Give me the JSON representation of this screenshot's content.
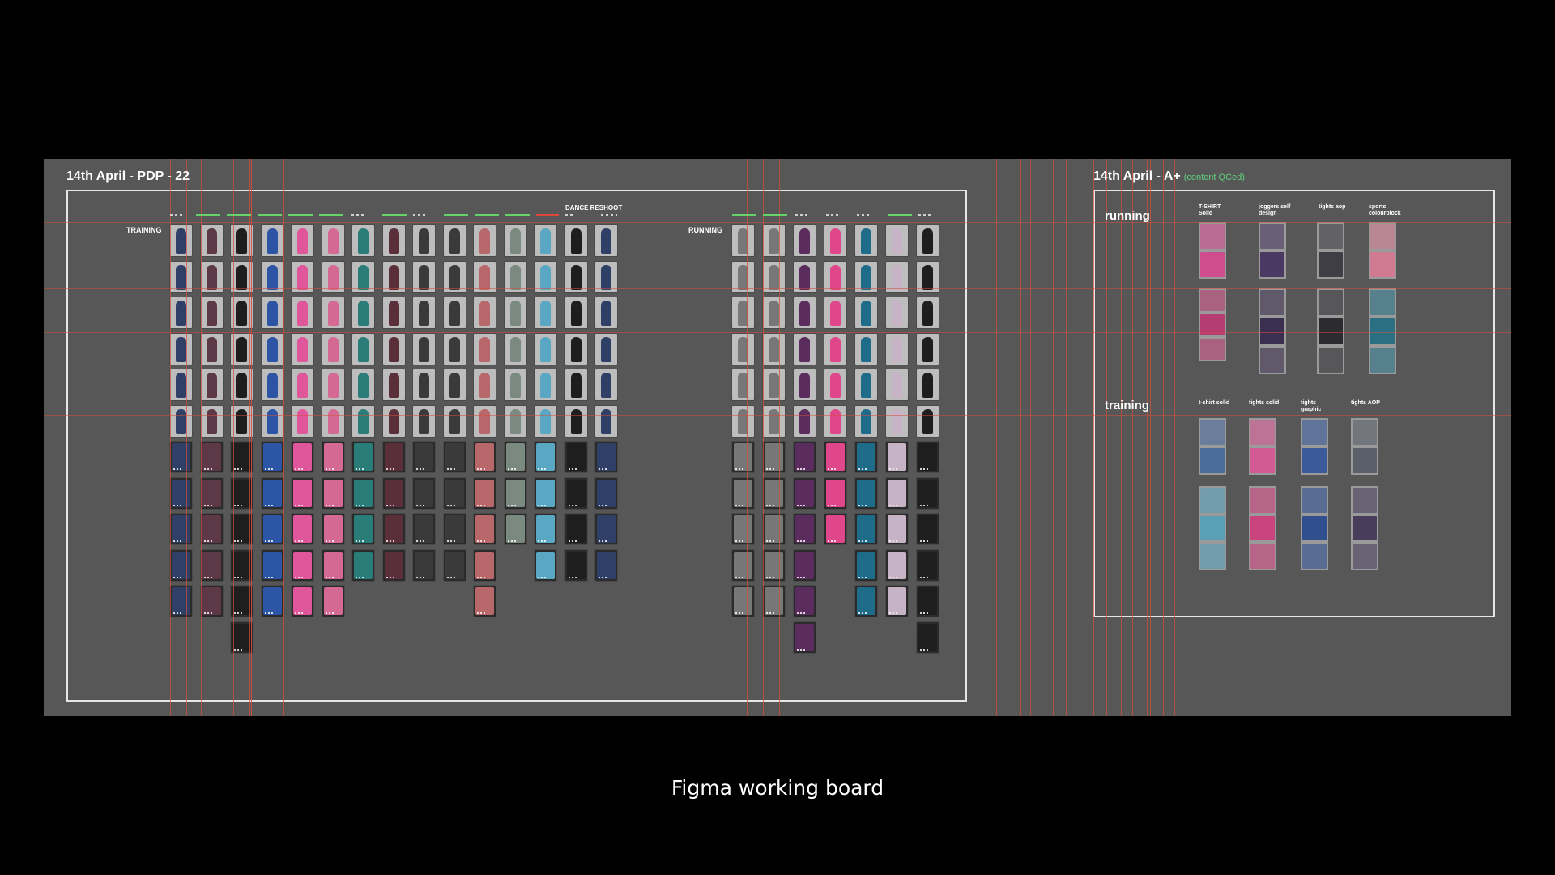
{
  "caption": "Figma working board",
  "frames": {
    "pdp": {
      "title": "14th April - PDP - 22"
    },
    "aplus": {
      "title": "14th April - A+",
      "note": "(content QCed)"
    }
  },
  "rows": {
    "training": "TRAINING",
    "running": "RUNNING"
  },
  "dance_reshoot": "DANCE RESHOOT",
  "aplus": {
    "running": {
      "label": "running",
      "columns": [
        "T-SHIRT Solid",
        "joggers self design",
        "tights aop",
        "sports colourblock"
      ]
    },
    "training": {
      "label": "training",
      "columns": [
        "t-shirt solid",
        "tights solid",
        "tights graphic",
        "tights AOP"
      ]
    }
  },
  "colors": {
    "board": "#575757",
    "guide": "#d64e3c",
    "status_done": "#63d36a",
    "status_flag": "#e0453a"
  }
}
